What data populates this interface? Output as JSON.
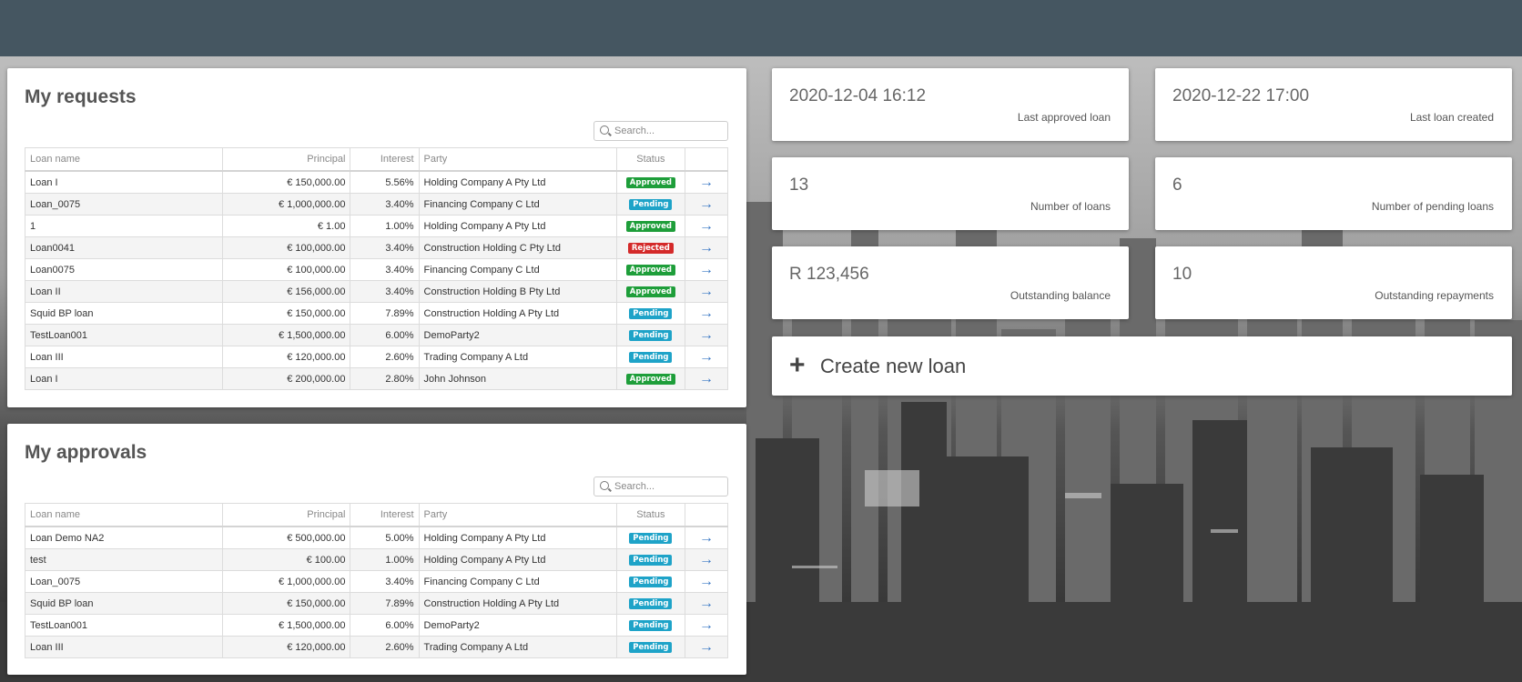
{
  "requests": {
    "title": "My requests",
    "search_placeholder": "Search...",
    "columns": [
      "Loan name",
      "Principal",
      "Interest",
      "Party",
      "Status"
    ],
    "rows": [
      {
        "name": "Loan I",
        "principal": "€ 150,000.00",
        "interest": "5.56%",
        "party": "Holding Company A Pty Ltd",
        "status": "Approved"
      },
      {
        "name": "Loan_0075",
        "principal": "€ 1,000,000.00",
        "interest": "3.40%",
        "party": "Financing Company C Ltd",
        "status": "Pending"
      },
      {
        "name": "1",
        "principal": "€ 1.00",
        "interest": "1.00%",
        "party": "Holding Company A Pty Ltd",
        "status": "Approved"
      },
      {
        "name": "Loan0041",
        "principal": "€ 100,000.00",
        "interest": "3.40%",
        "party": "Construction Holding C Pty Ltd",
        "status": "Rejected"
      },
      {
        "name": "Loan0075",
        "principal": "€ 100,000.00",
        "interest": "3.40%",
        "party": "Financing Company C Ltd",
        "status": "Approved"
      },
      {
        "name": "Loan II",
        "principal": "€ 156,000.00",
        "interest": "3.40%",
        "party": "Construction Holding B Pty Ltd",
        "status": "Approved"
      },
      {
        "name": "Squid BP loan",
        "principal": "€ 150,000.00",
        "interest": "7.89%",
        "party": "Construction Holding A Pty Ltd",
        "status": "Pending"
      },
      {
        "name": "TestLoan001",
        "principal": "€ 1,500,000.00",
        "interest": "6.00%",
        "party": "DemoParty2",
        "status": "Pending"
      },
      {
        "name": "Loan III",
        "principal": "€ 120,000.00",
        "interest": "2.60%",
        "party": "Trading Company A Ltd",
        "status": "Pending"
      },
      {
        "name": "Loan I",
        "principal": "€ 200,000.00",
        "interest": "2.80%",
        "party": "John Johnson",
        "status": "Approved"
      }
    ]
  },
  "approvals": {
    "title": "My approvals",
    "search_placeholder": "Search...",
    "columns": [
      "Loan name",
      "Principal",
      "Interest",
      "Party",
      "Status"
    ],
    "rows": [
      {
        "name": "Loan Demo NA2",
        "principal": "€ 500,000.00",
        "interest": "5.00%",
        "party": "Holding Company A Pty Ltd",
        "status": "Pending"
      },
      {
        "name": "test",
        "principal": "€ 100.00",
        "interest": "1.00%",
        "party": "Holding Company A Pty Ltd",
        "status": "Pending"
      },
      {
        "name": "Loan_0075",
        "principal": "€ 1,000,000.00",
        "interest": "3.40%",
        "party": "Financing Company C Ltd",
        "status": "Pending"
      },
      {
        "name": "Squid BP loan",
        "principal": "€ 150,000.00",
        "interest": "7.89%",
        "party": "Construction Holding A Pty Ltd",
        "status": "Pending"
      },
      {
        "name": "TestLoan001",
        "principal": "€ 1,500,000.00",
        "interest": "6.00%",
        "party": "DemoParty2",
        "status": "Pending"
      },
      {
        "name": "Loan III",
        "principal": "€ 120,000.00",
        "interest": "2.60%",
        "party": "Trading Company A Ltd",
        "status": "Pending"
      }
    ]
  },
  "status_colors": {
    "Approved": "#1e9e3a",
    "Pending": "#1ea3c8",
    "Rejected": "#d42a2a"
  },
  "row_action_icon": "arrow-right-icon",
  "stats": [
    {
      "value": "2020-12-04 16:12",
      "label": "Last approved loan"
    },
    {
      "value": "2020-12-22 17:00",
      "label": "Last loan created"
    },
    {
      "value": "13",
      "label": "Number of loans"
    },
    {
      "value": "6",
      "label": "Number of pending loans"
    },
    {
      "value": "R 123,456",
      "label": "Outstanding balance"
    },
    {
      "value": "10",
      "label": "Outstanding repayments"
    }
  ],
  "create_loan": {
    "icon": "plus-icon",
    "label": "Create new loan"
  },
  "colors": {
    "topbar": "#455661",
    "link": "#3b78c4"
  }
}
